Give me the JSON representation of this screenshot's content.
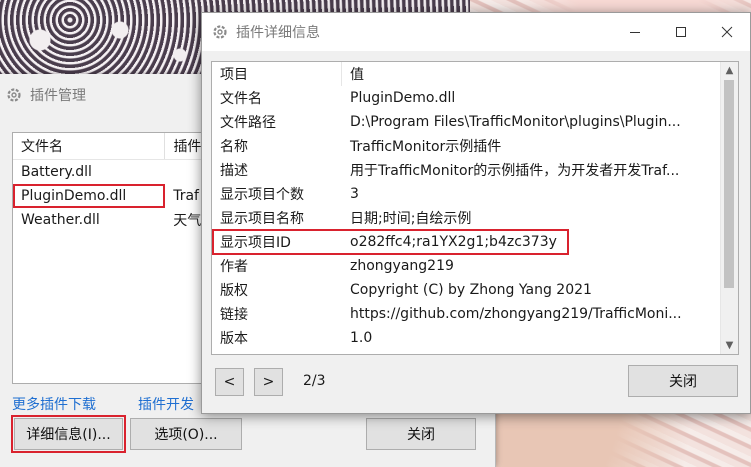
{
  "plugin_manager": {
    "title": "插件管理",
    "columns": [
      "文件名",
      "插件"
    ],
    "rows": [
      {
        "file": "Battery.dll",
        "name": ""
      },
      {
        "file": "PluginDemo.dll",
        "name": "Traf"
      },
      {
        "file": "Weather.dll",
        "name": "天气"
      }
    ],
    "links": {
      "more_download": "更多插件下载",
      "dev_guide": "插件开发"
    },
    "buttons": {
      "details": "详细信息(I)...",
      "options": "选项(O)...",
      "close": "关闭"
    }
  },
  "details_dialog": {
    "title": "插件详细信息",
    "header": {
      "key": "项目",
      "value": "值"
    },
    "rows": [
      {
        "key": "文件名",
        "value": "PluginDemo.dll"
      },
      {
        "key": "文件路径",
        "value": "D:\\Program Files\\TrafficMonitor\\plugins\\Plugin..."
      },
      {
        "key": "名称",
        "value": "TrafficMonitor示例插件"
      },
      {
        "key": "描述",
        "value": "用于TrafficMonitor的示例插件，为开发者开发Traf..."
      },
      {
        "key": "显示项目个数",
        "value": "3"
      },
      {
        "key": "显示项目名称",
        "value": "日期;时间;自绘示例"
      },
      {
        "key": "显示项目ID",
        "value": "o282ffc4;ra1YX2g1;b4zc373y"
      },
      {
        "key": "作者",
        "value": "zhongyang219"
      },
      {
        "key": "版权",
        "value": "Copyright (C) by Zhong Yang 2021"
      },
      {
        "key": "链接",
        "value": "https://github.com/zhongyang219/TrafficMoni..."
      },
      {
        "key": "版本",
        "value": "1.0"
      }
    ],
    "nav": {
      "prev": "<",
      "next": ">",
      "page": "2/3"
    },
    "close_button": "关闭"
  },
  "colors": {
    "highlight_frame": "#d9222e",
    "link": "#1f6fd1"
  }
}
